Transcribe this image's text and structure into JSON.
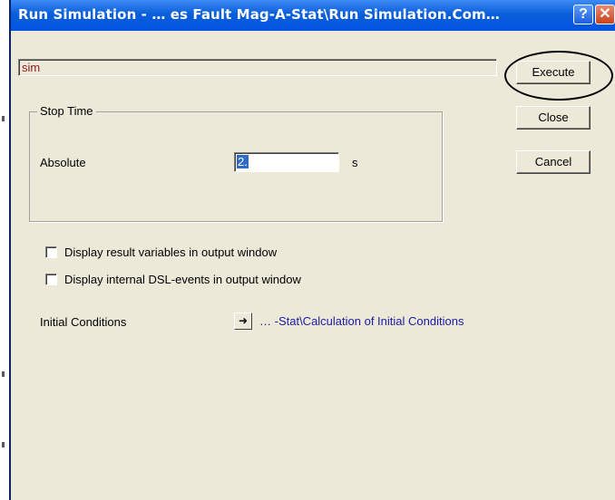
{
  "window": {
    "title": "Run Simulation - … es Fault Mag-A-Stat\\Run Simulation.Com…",
    "help_symbol": "?",
    "close_symbol": "✕"
  },
  "name_field": {
    "value": "sim"
  },
  "buttons": {
    "execute": "Execute",
    "close": "Close",
    "cancel": "Cancel"
  },
  "stop_time": {
    "group_label": "Stop Time",
    "absolute_label": "Absolute",
    "value": "2.",
    "unit": "s"
  },
  "options": [
    {
      "label": "Display result variables in output window",
      "checked": false
    },
    {
      "label": "Display internal DSL-events in output window",
      "checked": false
    }
  ],
  "initial_conditions": {
    "label": "Initial Conditions",
    "arrow_symbol": "➜",
    "link": "… -Stat\\Calculation of Initial Conditions"
  },
  "colors": {
    "titlebar": "#0054e3",
    "dialog_bg": "#ece9d8",
    "name_text": "#8b1a1a",
    "link": "#1a1aa6",
    "selection": "#316ac5"
  }
}
